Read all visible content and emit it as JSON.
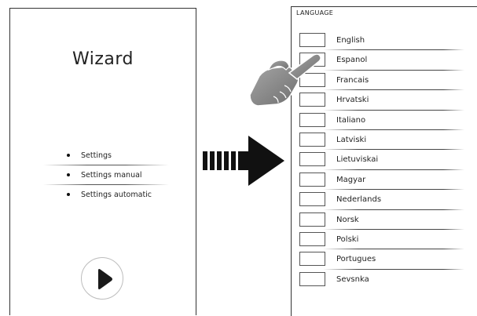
{
  "left_screen": {
    "title": "Wizard",
    "menu": [
      {
        "label": "Settings"
      },
      {
        "label": "Settings manual"
      },
      {
        "label": "Settings automatic"
      }
    ],
    "play_icon": "play-icon"
  },
  "arrow_icon": "arrow-right-icon",
  "hand_icon": "pointing-hand-icon",
  "right_screen": {
    "header": "LANGUAGE",
    "languages": [
      {
        "label": "English"
      },
      {
        "label": "Espanol"
      },
      {
        "label": "Francais"
      },
      {
        "label": "Hrvatski"
      },
      {
        "label": "Italiano"
      },
      {
        "label": "Latviski"
      },
      {
        "label": "Lietuviskai"
      },
      {
        "label": "Magyar"
      },
      {
        "label": "Nederlands"
      },
      {
        "label": "Norsk"
      },
      {
        "label": "Polski"
      },
      {
        "label": "Portugues"
      },
      {
        "label": "Sevsnka"
      }
    ]
  },
  "colors": {
    "ink": "#1a1a1a",
    "play_ring": "#bdbdbd",
    "hand_fill": "#8a8a8a"
  }
}
